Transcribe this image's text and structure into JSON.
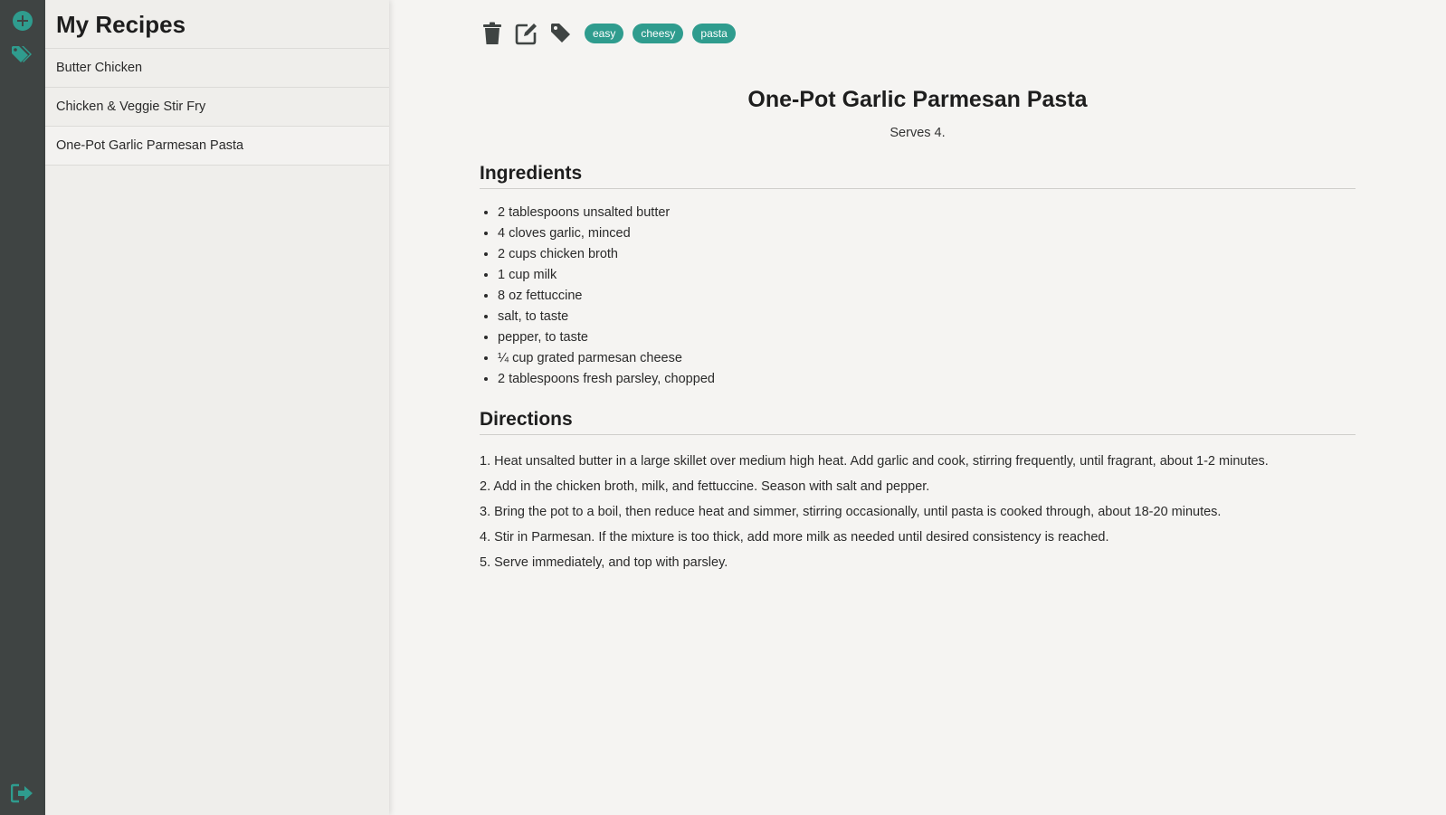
{
  "rail": {
    "icons": [
      "plus-circle-icon",
      "tags-icon",
      "sign-out-icon"
    ],
    "accent": "#2f9c8e"
  },
  "sidebar": {
    "title": "My Recipes",
    "items": [
      {
        "label": "Butter Chicken"
      },
      {
        "label": "Chicken & Veggie Stir Fry"
      },
      {
        "label": "One-Pot Garlic Parmesan Pasta",
        "active": true
      }
    ]
  },
  "toolbar": {
    "icons": [
      "trash-icon",
      "edit-icon",
      "tag-icon"
    ],
    "tags": [
      "easy",
      "cheesy",
      "pasta"
    ]
  },
  "recipe": {
    "title": "One-Pot Garlic Parmesan Pasta",
    "serves": "Serves 4.",
    "ingredients_heading": "Ingredients",
    "ingredients": [
      "2 tablespoons unsalted butter",
      "4 cloves garlic, minced",
      "2 cups chicken broth",
      "1 cup milk",
      "8 oz fettuccine",
      "salt, to taste",
      "pepper, to taste",
      "¼ cup grated parmesan cheese",
      "2 tablespoons fresh parsley, chopped"
    ],
    "directions_heading": "Directions",
    "directions": [
      "1. Heat unsalted butter in a large skillet over medium high heat. Add garlic and cook, stirring frequently, until fragrant, about 1-2 minutes.",
      "2. Add in the chicken broth, milk, and fettuccine. Season with salt and pepper.",
      "3. Bring the pot to a boil, then reduce heat and simmer, stirring occasionally, until pasta is cooked through, about 18-20 minutes.",
      "4. Stir in Parmesan. If the mixture is too thick, add more milk as needed until desired consistency is reached.",
      "5. Serve immediately, and top with parsley."
    ]
  }
}
